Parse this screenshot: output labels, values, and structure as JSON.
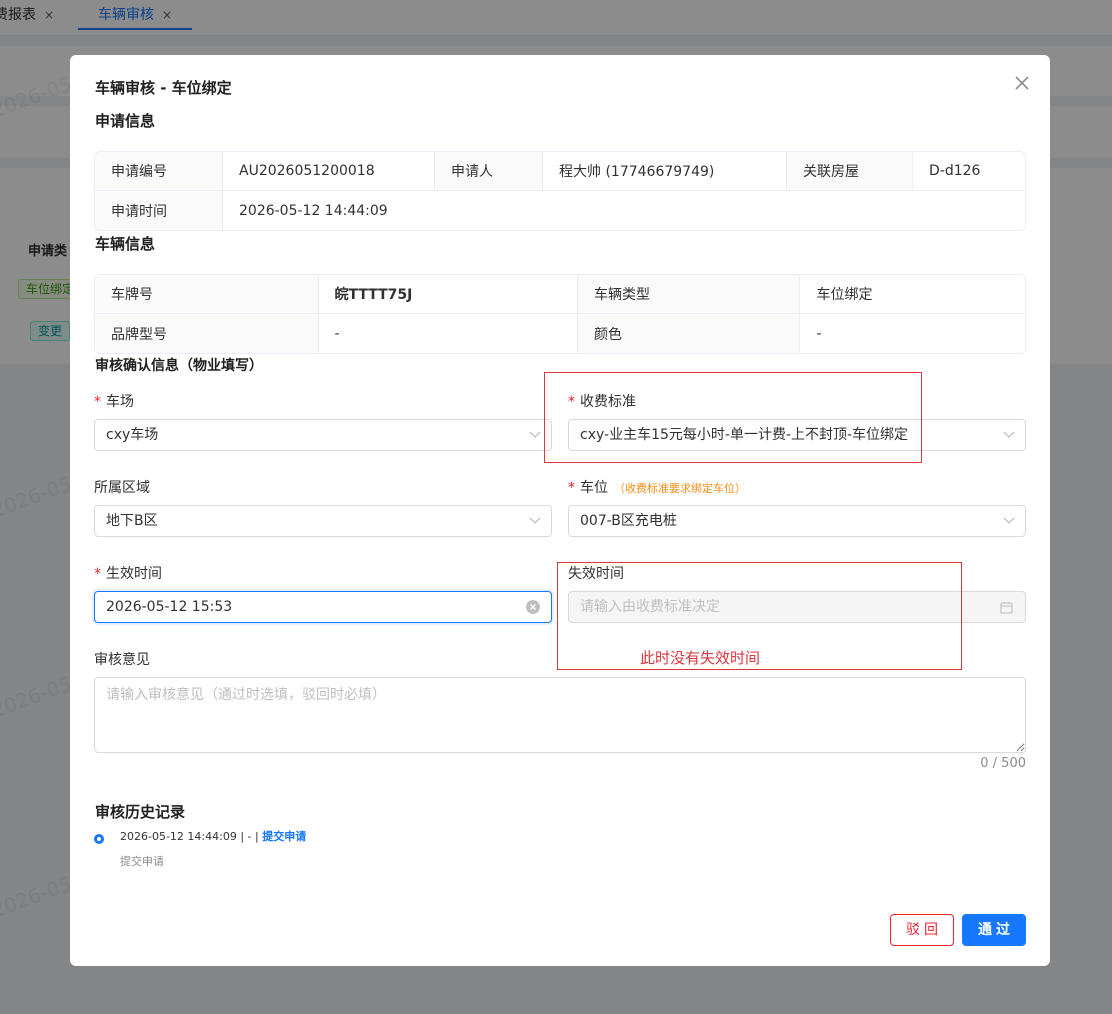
{
  "background": {
    "tabs": [
      {
        "label": "费报表",
        "close": "×"
      },
      {
        "label": "车辆审核",
        "close": "×"
      }
    ],
    "table_header": "申请类",
    "tags": [
      "车位绑定",
      "变更"
    ],
    "watermark": "2026-05"
  },
  "dialog": {
    "title": "车辆审核 - 车位绑定",
    "close_icon": "close-icon"
  },
  "apply_info": {
    "section_title": "申请信息",
    "rows": [
      [
        {
          "label": "申请编号",
          "value": "AU2026051200018"
        },
        {
          "label": "申请人",
          "value": "程大帅 (17746679749)"
        },
        {
          "label": "关联房屋",
          "value": "D-d126"
        }
      ],
      [
        {
          "label": "申请时间",
          "value": "2026-05-12 14:44:09"
        }
      ]
    ]
  },
  "vehicle_info": {
    "section_title": "车辆信息",
    "rows": [
      [
        {
          "label": "车牌号",
          "value": "皖TTTT75J"
        },
        {
          "label": "车辆类型",
          "value": "车位绑定"
        }
      ],
      [
        {
          "label": "品牌型号",
          "value": "-"
        },
        {
          "label": "颜色",
          "value": "-"
        }
      ]
    ]
  },
  "review_form": {
    "section_title": "审核确认信息（物业填写）",
    "parking_lot": {
      "label": "车场",
      "value": "cxy车场",
      "required_mark": "*"
    },
    "fee_standard": {
      "label": "收费标准",
      "value": "cxy-业主车15元每小时-单一计费-上不封顶-车位绑定",
      "required_mark": "*"
    },
    "area": {
      "label": "所属区域",
      "value": "地下B区"
    },
    "space": {
      "label": "车位",
      "hint": "（收费标准要求绑定车位）",
      "value": "007-B区充电桩",
      "required_mark": "*"
    },
    "effective_time": {
      "label": "生效时间",
      "value": "2026-05-12 15:53",
      "required_mark": "*"
    },
    "expire_time": {
      "label": "失效时间",
      "placeholder": "请输入由收费标准决定"
    },
    "opinion": {
      "label": "审核意见",
      "placeholder": "请输入审核意见（通过时选填，驳回时必填）",
      "counter": "0 / 500"
    }
  },
  "annotation": {
    "note": "此时没有失效时间",
    "color": "#d9363e"
  },
  "history": {
    "section_title": "审核历史记录",
    "items": [
      {
        "meta": "2026-05-12 14:44:09 | - | ",
        "action": "提交申请",
        "desc": "提交申请"
      }
    ]
  },
  "footer": {
    "reject_label": "驳回",
    "pass_label": "通过"
  },
  "colors": {
    "primary": "#1677ff",
    "danger": "#f5222d",
    "warning": "#fa8c16"
  }
}
